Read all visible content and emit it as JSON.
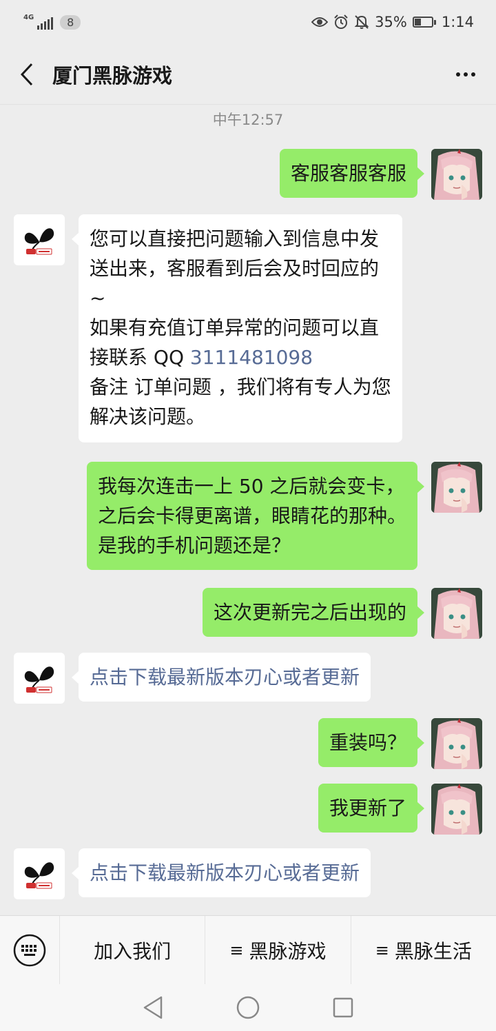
{
  "status_bar": {
    "network": "4G",
    "notification_count": "8",
    "battery": "35%",
    "time": "1:14",
    "battery_level": 0.35
  },
  "header": {
    "title": "厦门黑脉游戏"
  },
  "chat": {
    "timestamp": "中午12:57",
    "messages": [
      {
        "side": "out",
        "text": "客服客服客服"
      },
      {
        "side": "in",
        "text_before": "您可以直接把问题输入到信息中发\n送出来，客服看到后会及时回应的\n~\n如果有充值订单异常的问题可以直\n接联系 QQ ",
        "qq": "3111481098",
        "text_after": "\n备注 订单问题 ，我们将有专人为您\n解决该问题。"
      },
      {
        "side": "out",
        "text": "我每次连击一上 50 之后就会变卡，\n之后会卡得更离谱，眼睛花的那种。\n是我的手机问题还是？"
      },
      {
        "side": "out",
        "text": "这次更新完之后出现的"
      },
      {
        "side": "in",
        "text": "点击下载最新版本刃心或者更新"
      },
      {
        "side": "out",
        "text": "重装吗？"
      },
      {
        "side": "out",
        "text": "我更新了"
      },
      {
        "side": "in",
        "text": "点击下载最新版本刃心或者更新"
      }
    ]
  },
  "menu": {
    "items": [
      {
        "label": "加入我们",
        "has_list_icon": false
      },
      {
        "label": "黑脉游戏",
        "has_list_icon": true
      },
      {
        "label": "黑脉生活",
        "has_list_icon": true
      }
    ],
    "list_icon_glyph": "≡"
  },
  "colors": {
    "background": "#ededed",
    "outgoing_bubble": "#95ec69",
    "incoming_bubble": "#ffffff",
    "link": "#576b95"
  },
  "icons": [
    "back-icon",
    "more-icon",
    "keyboard-icon",
    "eye-icon",
    "alarm-icon",
    "mute-icon",
    "battery-icon",
    "nav-back-icon",
    "nav-home-icon",
    "nav-recents-icon"
  ]
}
